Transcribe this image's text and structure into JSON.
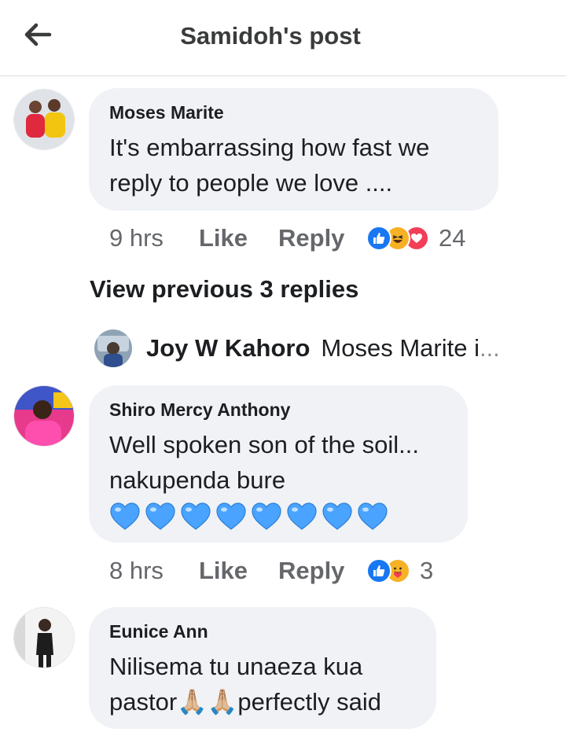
{
  "header": {
    "title": "Samidoh's post"
  },
  "comments": [
    {
      "author": "Moses Marite",
      "text_lines": [
        "It's  embarrassing  how fast we",
        "reply to people we love ...."
      ],
      "time": "9 hrs",
      "like_label": "Like",
      "reply_label": "Reply",
      "reactions": [
        "like-reaction-icon",
        "laugh-reaction-icon",
        "love-reaction-icon"
      ],
      "reaction_count": "24"
    },
    {
      "author": "Shiro Mercy Anthony",
      "text_lines": [
        "Well spoken son of the soil...",
        "nakupenda bure"
      ],
      "emoji_line": "💙💙💙💙💙💙💙💙",
      "time": "8 hrs",
      "like_label": "Like",
      "reply_label": "Reply",
      "reactions": [
        "like-reaction-icon",
        "care-reaction-icon"
      ],
      "reaction_count": "3"
    },
    {
      "author": "Eunice Ann",
      "text_lines": [
        "Nilisema tu unaeza kua",
        "pastor🙏🏼🙏🏼perfectly said"
      ]
    }
  ],
  "view_previous": "View previous 3 replies",
  "reply_preview": {
    "name": "Joy W Kahoro",
    "snippet": "Moses Marite i",
    "ellipsis": "..."
  },
  "colors": {
    "like_blue": "#1877f2",
    "love_red": "#f33e58",
    "haha_yellow": "#f7b125",
    "bubble_bg": "#f0f2f5",
    "meta_gray": "#65676b",
    "heart_blue": "#4aa3ff"
  }
}
